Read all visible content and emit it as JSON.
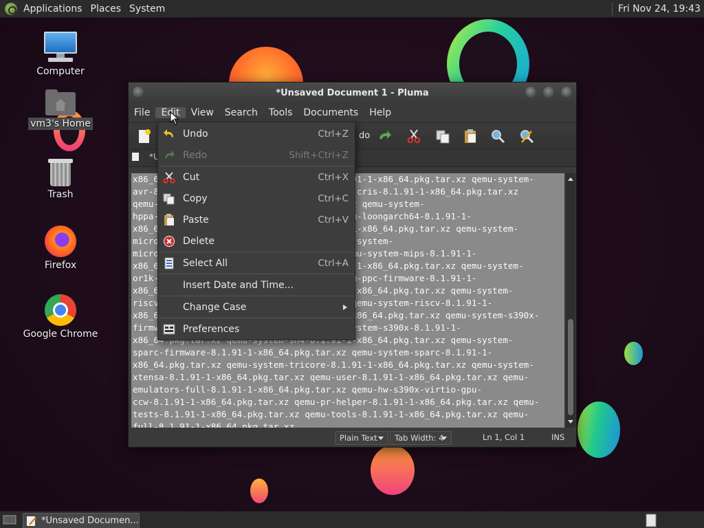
{
  "topbar": {
    "menus": [
      "Applications",
      "Places",
      "System"
    ],
    "clock": "Fri Nov 24, 19:43"
  },
  "desktop_icons": [
    "Computer",
    "vm3's Home",
    "Trash",
    "Firefox",
    "Google Chrome"
  ],
  "window": {
    "title": "*Unsaved Document 1 - Pluma",
    "menu": [
      "File",
      "Edit",
      "View",
      "Search",
      "Tools",
      "Documents",
      "Help"
    ],
    "toolbar_fragment": "do",
    "tab_label_fragment": "*U",
    "editor_text": "x86_64.pkg.tar.xz qemu-system-aarch64-8.1.91-1-x86_64.pkg.tar.xz qemu-system-\navr-8.1.91-1-x86_64.pkg.tar.xz qemu-system-cris-8.1.91-1-x86_64.pkg.tar.xz\nqemu-system-hppa-8.1.91-1-x86_64.pkg.tar.xz qemu-system-\nhppa-8.1.91-1-x86_64.pkg.tar.xz qemu-system-loongarch64-8.1.91-1-\nx86_64.pkg.tar.xz qemu-system-m68k-8.1.91-1-x86_64.pkg.tar.xz qemu-system-\nmicroblaze-8.1.91-1-x86_64.pkg.tar.xz qemu-system-\nmicroblazeel-8.1.91-1-x86_64.pkg.tar.xz qemu-system-mips-8.1.91-1-\nx86_64.pkg.tar.xz qemu-system-nios2-8.1.91-1-x86_64.pkg.tar.xz qemu-system-\nor1k-8.1.91-1-x86_64.pkg.tar.xz qemu-system-ppc-firmware-8.1.91-1-\nx86_64.pkg.tar.xz qemu-system-ppc-8.1.91-1-x86_64.pkg.tar.xz qemu-system-\nriscv-firmware-8.1.91-1-x86_64.pkg.tar.xz qemu-system-riscv-8.1.91-1-\nx86_64.pkg.tar.xz qemu-system-rx-8.1.91-1-x86_64.pkg.tar.xz qemu-system-s390x-\nfirmware-8.1.91-1-x86_64.pkg.tar.xz qemu-system-s390x-8.1.91-1-\nx86_64.pkg.tar.xz qemu-system-sh4-8.1.91-1-x86_64.pkg.tar.xz qemu-system-\nsparc-firmware-8.1.91-1-x86_64.pkg.tar.xz qemu-system-sparc-8.1.91-1-\nx86_64.pkg.tar.xz qemu-system-tricore-8.1.91-1-x86_64.pkg.tar.xz qemu-system-\nxtensa-8.1.91-1-x86_64.pkg.tar.xz qemu-user-8.1.91-1-x86_64.pkg.tar.xz qemu-\nemulators-full-8.1.91-1-x86_64.pkg.tar.xz qemu-hw-s390x-virtio-gpu-\nccw-8.1.91-1-x86_64.pkg.tar.xz qemu-pr-helper-8.1.91-1-x86_64.pkg.tar.xz qemu-\ntests-8.1.91-1-x86_64.pkg.tar.xz qemu-tools-8.1.91-1-x86_64.pkg.tar.xz qemu-\nfull-8.1.91-1-x86_64.pkg.tar.xz",
    "status": {
      "syntax": "Plain Text",
      "tab_width": "Tab Width: 4",
      "position": "Ln 1, Col 1",
      "mode": "INS"
    }
  },
  "edit_menu": [
    {
      "label": "Undo",
      "accel": "Ctrl+Z",
      "icon": "undo-icon",
      "enabled": true
    },
    {
      "label": "Redo",
      "accel": "Shift+Ctrl+Z",
      "icon": "redo-icon",
      "enabled": false
    },
    {
      "label": "Cut",
      "accel": "Ctrl+X",
      "icon": "scissors-icon",
      "enabled": true
    },
    {
      "label": "Copy",
      "accel": "Ctrl+C",
      "icon": "copy-icon",
      "enabled": true
    },
    {
      "label": "Paste",
      "accel": "Ctrl+V",
      "icon": "paste-icon",
      "enabled": true
    },
    {
      "label": "Delete",
      "accel": "",
      "icon": "delete-icon",
      "enabled": true
    },
    {
      "label": "Select All",
      "accel": "Ctrl+A",
      "icon": "select-all-icon",
      "enabled": true
    },
    {
      "label": "Insert Date and Time...",
      "accel": "",
      "icon": "",
      "enabled": true
    },
    {
      "label": "Change Case",
      "accel": "",
      "icon": "submenu-arrow-icon",
      "enabled": true
    },
    {
      "label": "Preferences",
      "accel": "",
      "icon": "preferences-icon",
      "enabled": true
    }
  ],
  "taskbar": {
    "task_label": "*Unsaved Documen..."
  }
}
